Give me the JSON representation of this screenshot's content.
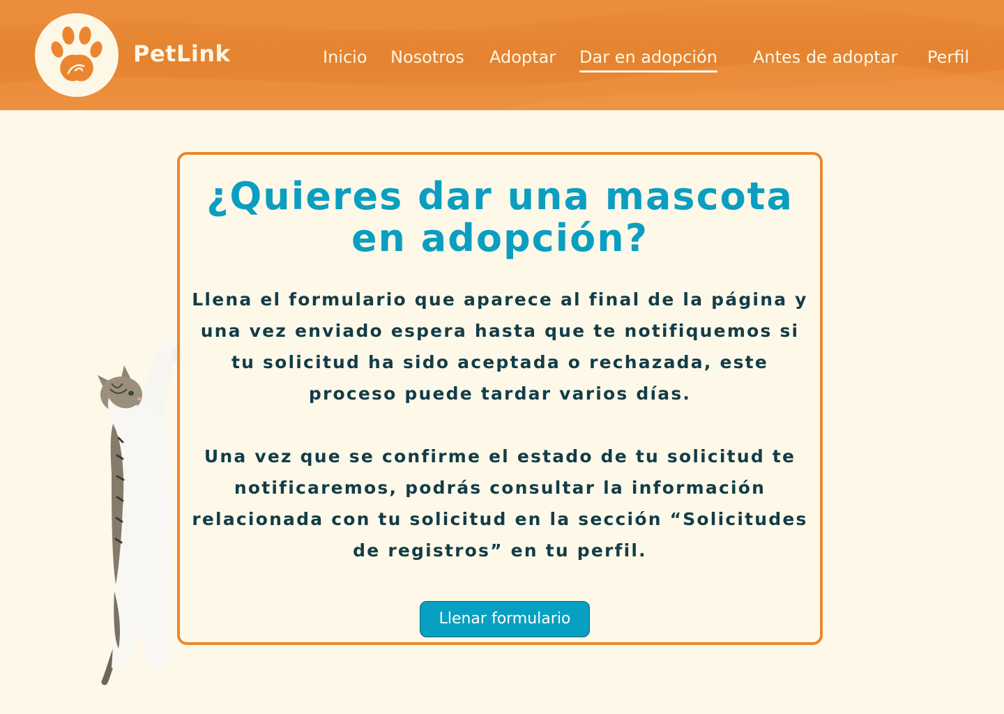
{
  "header": {
    "brand": "PetLink",
    "nav": [
      {
        "label": "Inicio"
      },
      {
        "label": "Nosotros"
      },
      {
        "label": "Adoptar"
      },
      {
        "label": "Dar en adopción"
      },
      {
        "label": "Antes de adoptar"
      },
      {
        "label": "Perfil"
      }
    ],
    "active_index": 3
  },
  "main": {
    "title": "¿Quieres dar una mascota en adopción?",
    "paragraphs": [
      "Llena el formulario que aparece al final de la página y una vez enviado espera hasta que te notifiquemos si tu solicitud ha sido aceptada o rechazada, este proceso puede tardar varios días.",
      "Una vez que se confirme el estado de tu solicitud te notificaremos, podrás consultar la información relacionada con tu solicitud en la sección “Solicitudes de registros” en tu perfil."
    ],
    "cta_label": "Llenar formulario"
  },
  "colors": {
    "header_orange": "#e5832f",
    "cream": "#fdf8e8",
    "title_teal": "#0b9ec1",
    "text_dark": "#123c48",
    "button_teal": "#07a0c2",
    "card_border": "#ec8530"
  },
  "icons": {
    "logo": "paw-heart-icon",
    "decoration": "cat-illustration"
  }
}
